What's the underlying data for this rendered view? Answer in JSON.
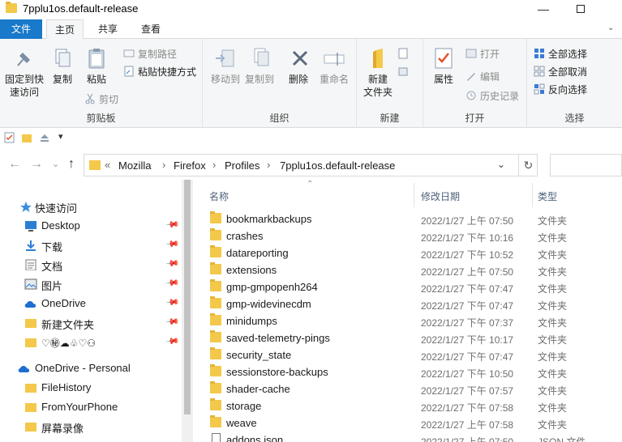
{
  "window": {
    "title": "7pplu1os.default-release",
    "minimize_glyph": "—"
  },
  "tabs": {
    "file": "文件",
    "home": "主页",
    "share": "共享",
    "view": "查看",
    "expand_glyph": "⌄"
  },
  "ribbon": {
    "clipboard": {
      "label": "剪贴板",
      "pin": "固定到快\n速访问",
      "copy": "复制",
      "paste": "粘贴",
      "copy_path": "复制路径",
      "paste_shortcut": "粘贴快捷方式",
      "cut": "剪切"
    },
    "organize": {
      "label": "组织",
      "move_to": "移动到",
      "copy_to": "复制到",
      "delete": "删除",
      "rename": "重命名"
    },
    "new": {
      "label": "新建",
      "new_folder": "新建\n文件夹"
    },
    "open": {
      "label": "打开",
      "properties": "属性",
      "open": "打开",
      "edit": "编辑",
      "history": "历史记录"
    },
    "select": {
      "label": "选择",
      "select_all": "全部选择",
      "select_none": "全部取消",
      "invert": "反向选择"
    }
  },
  "qat": {
    "dropdown_glyph": "▾"
  },
  "nav": {
    "back": "←",
    "forward": "→",
    "recent": "⌄",
    "up": "↑"
  },
  "address": {
    "overflow": "«",
    "crumbs": [
      "Mozilla",
      "Firefox",
      "Profiles",
      "7pplu1os.default-release"
    ],
    "separator": "›",
    "dropdown_glyph": "⌄",
    "refresh_glyph": "↻"
  },
  "sidebar": {
    "pin_glyph": "📌",
    "items": [
      {
        "label": "快速访问"
      },
      {
        "label": "Desktop"
      },
      {
        "label": "下载"
      },
      {
        "label": "文档"
      },
      {
        "label": "图片"
      },
      {
        "label": "OneDrive"
      },
      {
        "label": "新建文件夹"
      },
      {
        "label": "♡㊙☁♧♡⚇"
      },
      {
        "label": "OneDrive - Personal"
      },
      {
        "label": "FileHistory"
      },
      {
        "label": "FromYourPhone"
      },
      {
        "label": "屏幕录像"
      }
    ]
  },
  "columns": {
    "name": "名称",
    "modified": "修改日期",
    "type": "类型",
    "sort_glyph": "⌃"
  },
  "files": [
    {
      "name": "bookmarkbackups",
      "date": "2022/1/27 上午 07:50",
      "type": "文件夹"
    },
    {
      "name": "crashes",
      "date": "2022/1/27 下午 10:16",
      "type": "文件夹"
    },
    {
      "name": "datareporting",
      "date": "2022/1/27 下午 10:52",
      "type": "文件夹"
    },
    {
      "name": "extensions",
      "date": "2022/1/27 上午 07:50",
      "type": "文件夹"
    },
    {
      "name": "gmp-gmpopenh264",
      "date": "2022/1/27 下午 07:47",
      "type": "文件夹"
    },
    {
      "name": "gmp-widevinecdm",
      "date": "2022/1/27 下午 07:47",
      "type": "文件夹"
    },
    {
      "name": "minidumps",
      "date": "2022/1/27 下午 07:37",
      "type": "文件夹"
    },
    {
      "name": "saved-telemetry-pings",
      "date": "2022/1/27 下午 10:17",
      "type": "文件夹"
    },
    {
      "name": "security_state",
      "date": "2022/1/27 下午 07:47",
      "type": "文件夹"
    },
    {
      "name": "sessionstore-backups",
      "date": "2022/1/27 下午 10:50",
      "type": "文件夹"
    },
    {
      "name": "shader-cache",
      "date": "2022/1/27 下午 07:57",
      "type": "文件夹"
    },
    {
      "name": "storage",
      "date": "2022/1/27 下午 07:58",
      "type": "文件夹"
    },
    {
      "name": "weave",
      "date": "2022/1/27 上午 07:58",
      "type": "文件夹"
    },
    {
      "name": "addons.json",
      "date": "2022/1/27 上午 07:50",
      "type": "JSON 文件"
    }
  ]
}
